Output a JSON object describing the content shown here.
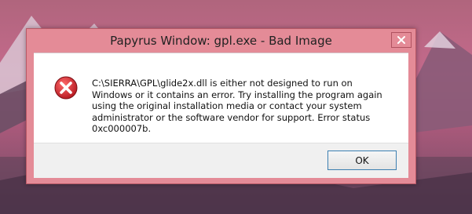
{
  "window": {
    "title": "Papyrus Window: gpl.exe - Bad Image"
  },
  "message": {
    "text": "C:\\SIERRA\\GPL\\glide2x.dll is either not designed to run on Windows or it contains an error. Try installing the program again using the original installation media or contact your system administrator or the software vendor for support. Error status 0xc000007b.",
    "icon": "error-icon"
  },
  "buttons": {
    "ok_label": "OK"
  },
  "colors": {
    "frame": "#e48b97",
    "accent": "#3c7fb1",
    "error_red": "#cc1f28"
  }
}
